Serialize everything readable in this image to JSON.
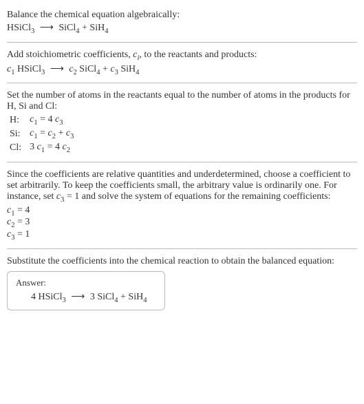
{
  "title": "Balance the chemical equation algebraically:",
  "intro_para2": "Add stoichiometric coefficients, ",
  "intro_para2_ci": "c",
  "intro_para2_i": "i",
  "intro_para2_rest": ", to the reactants and products:",
  "atoms_intro": "Set the number of atoms in the reactants equal to the number of atoms in the products for H, Si and Cl:",
  "atom_rows": {
    "H": {
      "label": "H:",
      "eq_lhs": "c",
      "eq_lhs_sub": "1",
      "eq_mid": " = 4 ",
      "eq_rhs": "c",
      "eq_rhs_sub": "3"
    },
    "Si": {
      "label": "Si:",
      "eq_pre": "c",
      "eq_pre_sub": "1",
      "eq_mid1": " = ",
      "eq_t1": "c",
      "eq_t1_sub": "2",
      "eq_plus": " + ",
      "eq_t2": "c",
      "eq_t2_sub": "3"
    },
    "Cl": {
      "label": "Cl:",
      "eq_num1": "3 ",
      "eq_c1": "c",
      "eq_c1_sub": "1",
      "eq_mid": " = 4 ",
      "eq_c2": "c",
      "eq_c2_sub": "2"
    }
  },
  "under_para": "Since the coefficients are relative quantities and underdetermined, choose a coefficient to set arbitrarily. To keep the coefficients small, the arbitrary value is ordinarily one. For instance, set ",
  "under_c3": "c",
  "under_c3_sub": "3",
  "under_para2": " = 1 and solve the system of equations for the remaining coefficients:",
  "coeffs": {
    "c1": {
      "sym": "c",
      "sub": "1",
      "val": " = 4"
    },
    "c2": {
      "sym": "c",
      "sub": "2",
      "val": " = 3"
    },
    "c3": {
      "sym": "c",
      "sub": "3",
      "val": " = 1"
    }
  },
  "subst_para": "Substitute the coefficients into the chemical reaction to obtain the balanced equation:",
  "answer_label": "Answer:",
  "eq": {
    "HSiCl3": "HSiCl",
    "sub3": "3",
    "arrow": "⟶",
    "SiCl4": "SiCl",
    "sub4": "4",
    "plus": " + ",
    "SiH4": "SiH",
    "c": "c",
    "s1": "1",
    "s2": "2",
    "s3": "3",
    "sp": " ",
    "n4": "4 ",
    "n3": "3 "
  }
}
